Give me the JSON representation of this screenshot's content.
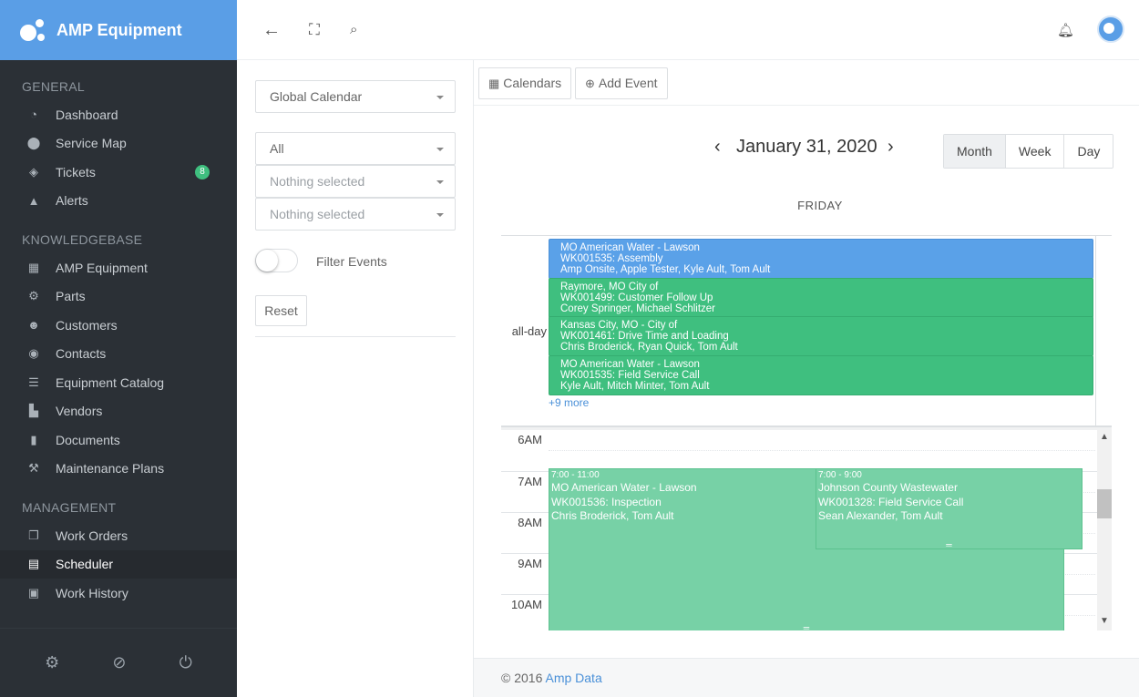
{
  "brand": {
    "name": "AMP Equipment"
  },
  "sidebar": {
    "sections": {
      "general": "GENERAL",
      "knowledgebase": "KNOWLEDGEBASE",
      "management": "MANAGEMENT"
    },
    "general": [
      {
        "label": "Dashboard",
        "icon": "dashboard-icon"
      },
      {
        "label": "Service Map",
        "icon": "map-pin-icon"
      },
      {
        "label": "Tickets",
        "icon": "ticket-icon",
        "badge": "8"
      },
      {
        "label": "Alerts",
        "icon": "alert-icon"
      }
    ],
    "knowledgebase": [
      {
        "label": "AMP Equipment",
        "icon": "building-icon"
      },
      {
        "label": "Parts",
        "icon": "gears-icon"
      },
      {
        "label": "Customers",
        "icon": "users-icon"
      },
      {
        "label": "Contacts",
        "icon": "user-circle-icon"
      },
      {
        "label": "Equipment Catalog",
        "icon": "list-icon"
      },
      {
        "label": "Vendors",
        "icon": "cart-icon"
      },
      {
        "label": "Documents",
        "icon": "file-icon"
      },
      {
        "label": "Maintenance Plans",
        "icon": "hammer-icon"
      }
    ],
    "management": [
      {
        "label": "Work Orders",
        "icon": "copy-icon"
      },
      {
        "label": "Scheduler",
        "icon": "calendar-icon",
        "active": true
      },
      {
        "label": "Work History",
        "icon": "calendar-check-icon"
      }
    ]
  },
  "filters": {
    "calendar_select": "Global Calendar",
    "type_select": "All",
    "select_2": "Nothing selected",
    "select_3": "Nothing selected",
    "filter_events_label": "Filter Events",
    "reset_label": "Reset"
  },
  "toolbar": {
    "calendars_label": "Calendars",
    "add_event_label": "Add Event"
  },
  "calendar": {
    "title": "January 31, 2020",
    "views": [
      "Month",
      "Week",
      "Day"
    ],
    "active_view": "Month",
    "day_name": "FRIDAY",
    "allday_label": "all-day",
    "allday_events": [
      {
        "line1": "MO American Water - Lawson",
        "line2": "WK001535: Assembly",
        "line3": "Amp Onsite, Apple Tester, Kyle Ault, Tom Ault",
        "color": "#5aa1e8"
      },
      {
        "line1": "Raymore, MO City of",
        "line2": "WK001499: Customer Follow Up",
        "line3": "Corey Springer, Michael Schlitzer",
        "color": "#3fbf7f"
      },
      {
        "line1": "Kansas City, MO - City of",
        "line2": "WK001461: Drive Time and Loading",
        "line3": "Chris Broderick, Ryan Quick, Tom Ault",
        "color": "#3fbf7f"
      },
      {
        "line1": "MO American Water - Lawson",
        "line2": "WK001535: Field Service Call",
        "line3": "Kyle Ault, Mitch Minter, Tom Ault",
        "color": "#3fbf7f"
      }
    ],
    "more_link": "+9 more",
    "hours": [
      "6AM",
      "7AM",
      "8AM",
      "9AM",
      "10AM"
    ],
    "timed_events": [
      {
        "time": "7:00 - 11:00",
        "line1": "MO American Water - Lawson",
        "line2": "WK001536: Inspection",
        "line3": "Chris Broderick, Tom Ault"
      },
      {
        "time": "7:00 - 9:00",
        "line1": "Johnson County Wastewater",
        "line2": "WK001328: Field Service Call",
        "line3": "Sean Alexander, Tom Ault"
      }
    ]
  },
  "footer": {
    "copyright": "© 2016",
    "company": "Amp Data"
  }
}
